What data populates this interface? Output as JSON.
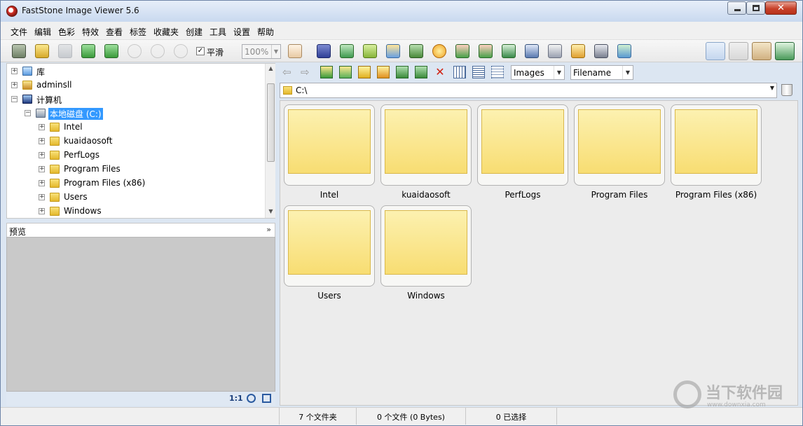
{
  "window": {
    "title": "FastStone Image Viewer 5.6"
  },
  "menu": [
    "文件",
    "编辑",
    "色彩",
    "特效",
    "查看",
    "标签",
    "收藏夹",
    "创建",
    "工具",
    "设置",
    "帮助"
  ],
  "toolbar": {
    "smooth_label": "平滑",
    "smooth_checked": "✓",
    "zoom_value": "100%"
  },
  "tree": {
    "items": [
      {
        "label": "库",
        "level": 0
      },
      {
        "label": "adminsll",
        "level": 0
      },
      {
        "label": "计算机",
        "level": 0
      },
      {
        "label": "本地磁盘 (C:)",
        "level": 1,
        "selected": true
      },
      {
        "label": "Intel",
        "level": 2
      },
      {
        "label": "kuaidaosoft",
        "level": 2
      },
      {
        "label": "PerfLogs",
        "level": 2
      },
      {
        "label": "Program Files",
        "level": 2
      },
      {
        "label": "Program Files (x86)",
        "level": 2
      },
      {
        "label": "Users",
        "level": 2
      },
      {
        "label": "Windows",
        "level": 2
      }
    ]
  },
  "preview": {
    "title": "预览",
    "footer_ratio": "1:1"
  },
  "browser": {
    "filter": "Images",
    "sort": "Filename",
    "path": "C:\\",
    "folders": [
      "Intel",
      "kuaidaosoft",
      "PerfLogs",
      "Program Files",
      "Program Files (x86)",
      "Users",
      "Windows"
    ]
  },
  "status": {
    "folders": "7 个文件夹",
    "files": "0 个文件 (0 Bytes)",
    "selected": "0 已选择"
  },
  "watermark": {
    "text": "当下软件园",
    "url": "www.downxia.com"
  },
  "colors": {
    "selection": "#3399ff",
    "thumb_fill": "#f8dd72",
    "close_button": "#c7412a"
  }
}
